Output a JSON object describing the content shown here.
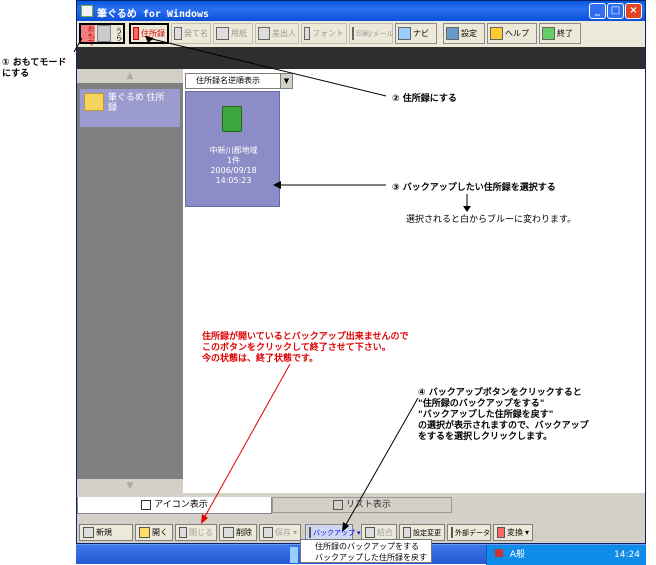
{
  "window": {
    "title": "筆ぐるめ for Windows",
    "minimize_glyph": "_",
    "maximize_glyph": "□",
    "close_glyph": "×"
  },
  "toolbar": {
    "omote_label": "おもて",
    "ura_label": "うら",
    "items": [
      {
        "label": "住所録",
        "icon": "address-book-icon"
      },
      {
        "label": "発て名",
        "icon": "addressing-icon"
      },
      {
        "label": "用紙",
        "icon": "paper-icon"
      },
      {
        "label": "差出人",
        "icon": "sender-icon"
      },
      {
        "label": "フォント",
        "icon": "font-icon"
      },
      {
        "label": "印刷/メール",
        "icon": "print-icon"
      },
      {
        "label": "ナビ",
        "icon": "navi-icon"
      },
      {
        "label": "設定",
        "icon": "settings-icon"
      },
      {
        "label": "ヘルプ",
        "icon": "help-icon"
      },
      {
        "label": "終了",
        "icon": "exit-icon"
      }
    ]
  },
  "sidebar": {
    "folder_label": "筆ぐるめ 住所録"
  },
  "main": {
    "sort_dropdown": "住所録名逆順表示",
    "address_book": {
      "name": "中新川郡地域",
      "count": "1件",
      "date": "2006/09/18",
      "time": "14:05:23"
    }
  },
  "tabs": {
    "icon_view": "アイコン表示",
    "list_view": "リスト表示"
  },
  "bottom_toolbar": {
    "new": "新規",
    "open": "開く",
    "close": "閉じる",
    "delete": "削除",
    "save": "保存",
    "backup": "バックアップ",
    "merge": "結合",
    "settings_change": "設定変更",
    "external_data": "外部データ",
    "convert": "変換"
  },
  "backup_menu": {
    "items": [
      "住所録のバックアップをする",
      "バックアップした住所録を戻す"
    ]
  },
  "taskbar": {
    "clock": "14:24",
    "ime": "A般"
  },
  "annotations": {
    "a1": "① おもてモード\nにする",
    "a2": "② 住所録にする",
    "a3": "③ バックアップしたい住所録を選択する",
    "a3_note": "選択されると白からブルーに変わります。",
    "red_note": "住所録が開いているとバックアップ出来ませんので\nこのボタンをクリックして終了させて下さい。\n今の状態は、終了状態です。",
    "a4": "④ バックアップボタンをクリックすると\n\"住所録のバックアップをする\"\n\"バックアップした住所録を戻す\"\nの選択が表示されますので、バックアップ\nをするを選択しクリックします。"
  },
  "colors": {
    "selected_card": "#8c8cc6",
    "annotation_red": "#e00000"
  }
}
